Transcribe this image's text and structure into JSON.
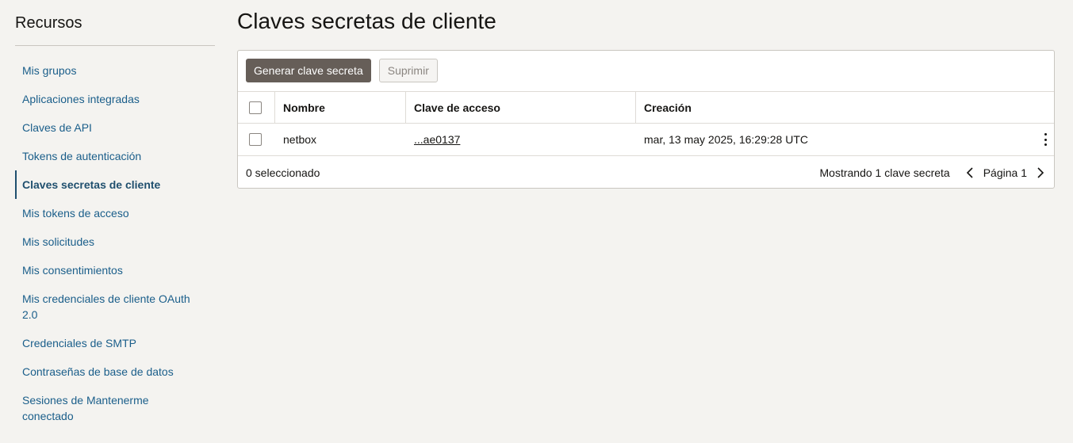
{
  "sidebar": {
    "title": "Recursos",
    "items": [
      {
        "label": "Mis grupos"
      },
      {
        "label": "Aplicaciones integradas"
      },
      {
        "label": "Claves de API"
      },
      {
        "label": "Tokens de autenticación"
      },
      {
        "label": "Claves secretas de cliente",
        "active": true
      },
      {
        "label": "Mis tokens de acceso"
      },
      {
        "label": "Mis solicitudes"
      },
      {
        "label": "Mis consentimientos"
      },
      {
        "label": "Mis credenciales de cliente OAuth 2.0"
      },
      {
        "label": "Credenciales de SMTP"
      },
      {
        "label": "Contraseñas de base de datos"
      },
      {
        "label": "Sesiones de Mantenerme conectado"
      }
    ]
  },
  "page": {
    "title": "Claves secretas de cliente"
  },
  "toolbar": {
    "generate_label": "Generar clave secreta",
    "delete_label": "Suprimir"
  },
  "table": {
    "columns": {
      "name": "Nombre",
      "access_key": "Clave de acceso",
      "created": "Creación"
    },
    "rows": [
      {
        "name": "netbox",
        "access_key": "...ae0137",
        "created": "mar, 13 may 2025, 16:29:28 UTC"
      }
    ]
  },
  "footer": {
    "selected": "0 seleccionado",
    "showing": "Mostrando 1 clave secreta",
    "page": "Página 1"
  },
  "colors": {
    "accent_link": "#1a5e8a",
    "primary_button": "#665e58",
    "background": "#f4f3f0"
  }
}
